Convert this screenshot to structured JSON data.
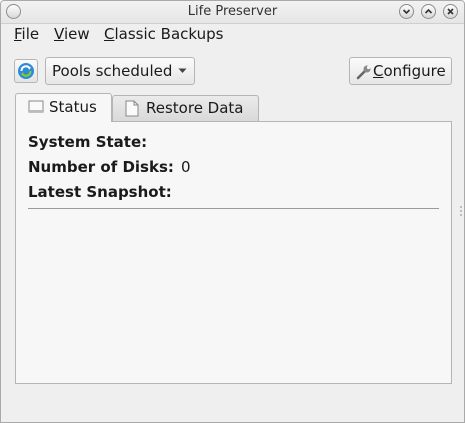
{
  "window": {
    "title": "Life Preserver"
  },
  "menu": {
    "file": {
      "accel": "F",
      "rest": "ile"
    },
    "view": {
      "accel": "V",
      "rest": "iew"
    },
    "classic": {
      "accel": "C",
      "rest": "lassic Backups"
    }
  },
  "toolbar": {
    "pool_selector_value": "Pools scheduled",
    "configure": {
      "accel": "C",
      "rest": "onfigure"
    }
  },
  "tabs": [
    {
      "label": "Status",
      "active": true
    },
    {
      "label": "Restore Data",
      "active": false
    }
  ],
  "status": {
    "system_state_label": "System State:",
    "system_state_value": "",
    "disks_label": "Number of Disks:",
    "disks_value": "0",
    "snapshot_label": "Latest Snapshot:",
    "snapshot_value": ""
  },
  "icons": {
    "refresh": "refresh-icon",
    "configure": "wrench-icon",
    "status_tab": "status-tab-icon",
    "restore_tab": "document-icon"
  }
}
